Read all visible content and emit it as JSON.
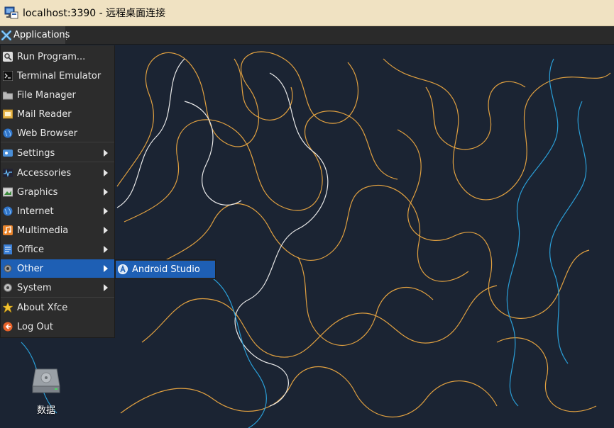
{
  "window": {
    "title": "localhost:3390 - 远程桌面连接",
    "icon": "remote-desktop-icon"
  },
  "panel": {
    "applications_label": "Applications",
    "applications_icon": "xfce-logo-icon"
  },
  "menu": {
    "items": [
      {
        "label": "Run Program...",
        "icon": "search-icon",
        "submenu": false
      },
      {
        "label": "Terminal Emulator",
        "icon": "terminal-icon",
        "submenu": false
      },
      {
        "label": "File Manager",
        "icon": "folder-icon",
        "submenu": false
      },
      {
        "label": "Mail Reader",
        "icon": "mail-icon",
        "submenu": false
      },
      {
        "label": "Web Browser",
        "icon": "globe-icon",
        "submenu": false
      },
      {
        "label": "Settings",
        "icon": "settings-icon",
        "submenu": true
      },
      {
        "label": "Accessories",
        "icon": "accessories-icon",
        "submenu": true
      },
      {
        "label": "Graphics",
        "icon": "graphics-icon",
        "submenu": true
      },
      {
        "label": "Internet",
        "icon": "globe-icon",
        "submenu": true
      },
      {
        "label": "Multimedia",
        "icon": "music-icon",
        "submenu": true
      },
      {
        "label": "Office",
        "icon": "document-icon",
        "submenu": true
      },
      {
        "label": "Other",
        "icon": "gear-icon",
        "submenu": true,
        "active": true
      },
      {
        "label": "System",
        "icon": "gear-icon",
        "submenu": true
      },
      {
        "label": "About Xfce",
        "icon": "star-icon",
        "submenu": false
      },
      {
        "label": "Log Out",
        "icon": "logout-icon",
        "submenu": false
      }
    ]
  },
  "submenu": {
    "items": [
      {
        "label": "Android Studio",
        "icon": "android-studio-icon",
        "active": true
      }
    ]
  },
  "desktop": {
    "icons": [
      {
        "label": "数据",
        "icon": "drive-icon"
      }
    ]
  },
  "colors": {
    "titlebar": "#f0e2c2",
    "panel": "#2a2a2a",
    "menu_bg": "#2c2c2c",
    "highlight": "#1e5fb4",
    "desktop_bg": "#1b2433",
    "line_orange": "#e0a040",
    "line_white": "#e8e8e8",
    "line_blue": "#2a9fd8"
  }
}
